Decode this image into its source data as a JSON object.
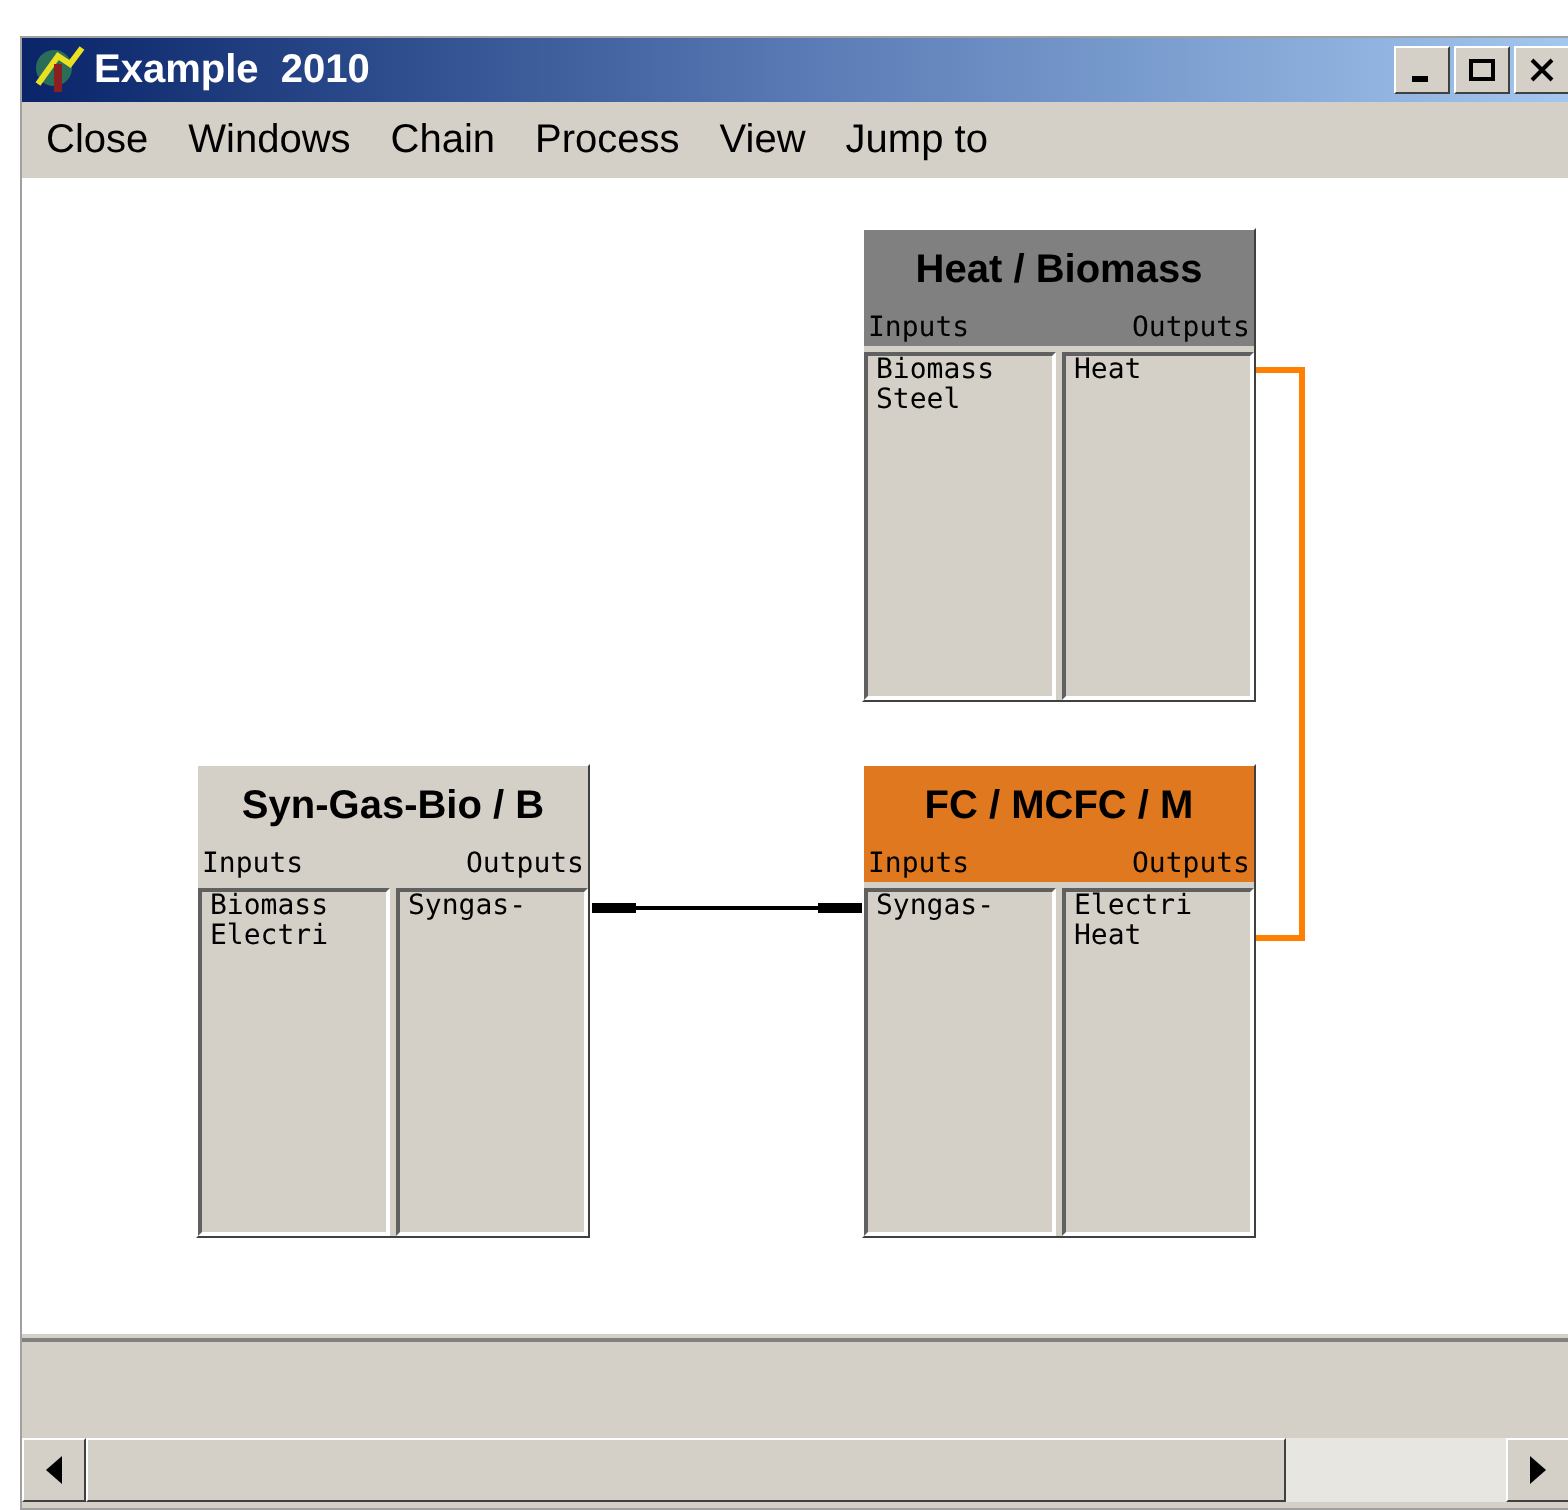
{
  "window": {
    "title": "Example  2010"
  },
  "menu": [
    "Close",
    "Windows",
    "Chain",
    "Process",
    "View",
    "Jump to"
  ],
  "nodes": [
    {
      "title": "Heat / Biomass",
      "color": "#808080",
      "inputs_label": "Inputs",
      "outputs_label": "Outputs",
      "inputs": [
        "Biomass",
        "Steel"
      ],
      "outputs": [
        "Heat"
      ]
    },
    {
      "title": "Syn-Gas-Bio / B",
      "color": "#d4d0c8",
      "inputs_label": "Inputs",
      "outputs_label": "Outputs",
      "inputs": [
        "Biomass",
        "Electri"
      ],
      "outputs": [
        "Syngas-"
      ]
    },
    {
      "title": "FC / MCFC / M",
      "color": "#e07820",
      "inputs_label": "Inputs",
      "outputs_label": "Outputs",
      "inputs": [
        "Syngas-"
      ],
      "outputs": [
        "Electri",
        "Heat"
      ]
    }
  ],
  "links": [
    {
      "color": "#000000"
    },
    {
      "color": "#ff8000"
    }
  ]
}
